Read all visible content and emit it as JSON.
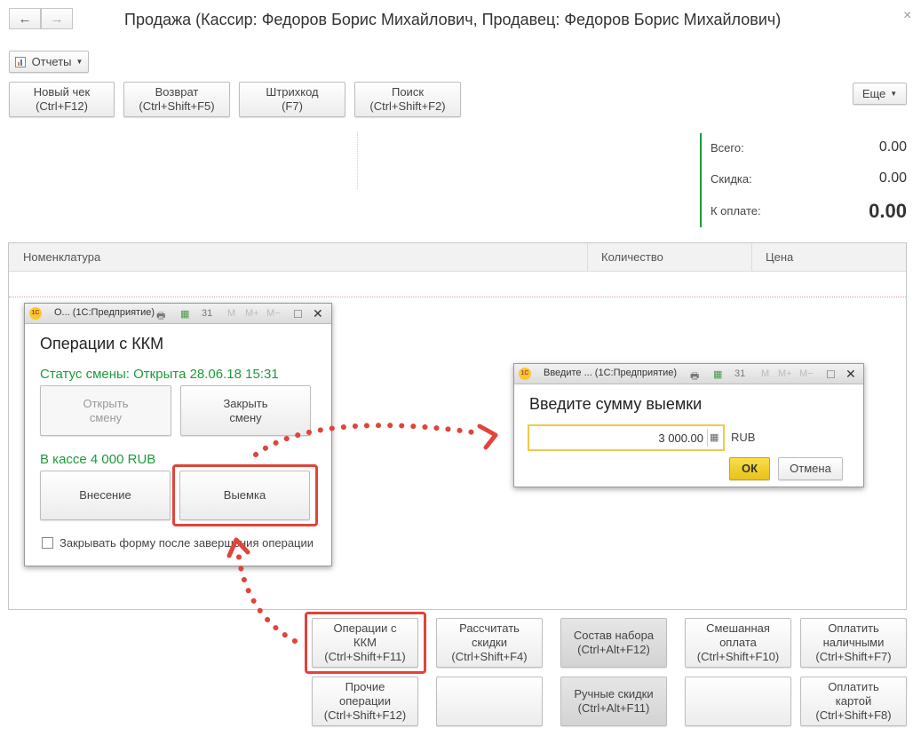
{
  "header": {
    "back_icon": "arrow-left",
    "forward_icon": "arrow-right",
    "title": "Продажа (Кассир: Федоров Борис Михайлович, Продавец: Федоров Борис Михайлович)",
    "close_symbol": "×"
  },
  "toolbar": {
    "reports_label": "Отчеты",
    "more_label": "Еще",
    "buttons": [
      {
        "line1": "Новый чек",
        "line2": "(Ctrl+F12)"
      },
      {
        "line1": "Возврат",
        "line2": "(Ctrl+Shift+F5)"
      },
      {
        "line1": "Штрихкод",
        "line2": "(F7)"
      },
      {
        "line1": "Поиск",
        "line2": "(Ctrl+Shift+F2)"
      }
    ]
  },
  "totals": {
    "total_label": "Всего:",
    "total_value": "0.00",
    "discount_label": "Скидка:",
    "discount_value": "0.00",
    "topay_label": "К оплате:",
    "topay_value": "0.00"
  },
  "table": {
    "columns": [
      "Номенклатура",
      "Количество",
      "Цена"
    ]
  },
  "kkm_window": {
    "title": "О...  (1С:Предприятие)",
    "heading": "Операции с ККМ",
    "shift_status": "Статус смены: Открыта 28.06.18 15:31",
    "open_shift_label": [
      "Открыть",
      "смену"
    ],
    "close_shift_label": [
      "Закрыть",
      "смену"
    ],
    "cash_status": "В кассе 4 000 RUB",
    "deposit_label": "Внесение",
    "withdraw_label": "Выемка",
    "close_checkbox_label": "Закрывать форму после завершения операции"
  },
  "amount_window": {
    "title": "Введите ...  (1С:Предприятие)",
    "heading": "Введите сумму выемки",
    "amount_value": "3 000.00",
    "currency": "RUB",
    "ok_label": "ОК",
    "cancel_label": "Отмена"
  },
  "bottom_buttons": {
    "row1": [
      [
        "Операции с",
        "ККМ",
        "(Ctrl+Shift+F11)"
      ],
      [
        "Рассчитать",
        "скидки",
        "(Ctrl+Shift+F4)"
      ],
      [
        "Состав набора",
        "(Ctrl+Alt+F12)"
      ],
      [
        "Смешанная",
        "оплата",
        "(Ctrl+Shift+F10)"
      ],
      [
        "Оплатить",
        "наличными",
        "(Ctrl+Shift+F7)"
      ]
    ],
    "row2": [
      [
        "Прочие",
        "операции",
        "(Ctrl+Shift+F12)"
      ],
      [],
      [
        "Ручные скидки",
        "(Ctrl+Alt+F11)"
      ],
      [],
      [
        "Оплатить",
        "картой",
        "(Ctrl+Shift+F8)"
      ]
    ]
  },
  "colors": {
    "highlight": "#e0443a",
    "accent_green": "#1e9a3a",
    "ok_yellow": "#f5d020"
  }
}
